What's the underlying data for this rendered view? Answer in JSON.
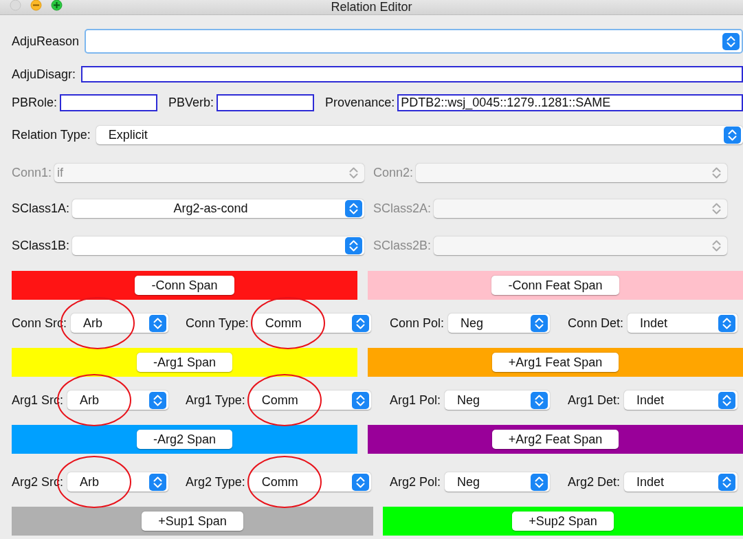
{
  "window": {
    "title": "Relation Editor"
  },
  "adju_reason": {
    "label": "AdjuReason",
    "focused": true
  },
  "adju_disagr": {
    "label": "AdjuDisagr:"
  },
  "pb_fields": [
    {
      "label": "PBRole:"
    },
    {
      "label": "PBVerb:"
    },
    {
      "label": "Provenance:",
      "value": "PDTB2::wsj_0045::1279..1281::SAME"
    }
  ],
  "relation_type": {
    "label": "Relation Type:",
    "value": "Explicit"
  },
  "class_rows": [
    [
      {
        "label": "Conn1:",
        "value": "if",
        "disabled": true
      },
      {
        "label": "Conn2:",
        "disabled": true
      }
    ],
    [
      {
        "label": "SClass1A:",
        "value": "Arg2-as-cond",
        "disabled": false
      },
      {
        "label": "SClass2A:",
        "disabled": true
      }
    ],
    [
      {
        "label": "SClass1B:",
        "disabled": false
      },
      {
        "label": "SClass2B:",
        "disabled": true
      }
    ]
  ],
  "sections": [
    {
      "spans": [
        {
          "label": "-Conn Span",
          "color": "#ff1414"
        },
        {
          "label": "-Conn Feat Span",
          "color": "#ffc0cb"
        }
      ],
      "attributes": [
        {
          "label": "Conn Src:",
          "value": "Arb",
          "circled": true
        },
        {
          "label": "Conn Type:",
          "value": "Comm",
          "circled": true
        },
        {
          "label": "Conn Pol:",
          "value": "Neg",
          "circled": false
        },
        {
          "label": "Conn Det:",
          "value": "Indet",
          "circled": false
        }
      ]
    },
    {
      "spans": [
        {
          "label": "-Arg1 Span",
          "color": "#ffff00"
        },
        {
          "label": "+Arg1 Feat Span",
          "color": "#ffa500"
        }
      ],
      "attributes": [
        {
          "label": "Arg1 Src:",
          "value": "Arb",
          "circled": true
        },
        {
          "label": "Arg1 Type:",
          "value": "Comm",
          "circled": true
        },
        {
          "label": "Arg1 Pol:",
          "value": "Neg",
          "circled": false
        },
        {
          "label": "Arg1 Det:",
          "value": "Indet",
          "circled": false
        }
      ]
    },
    {
      "spans": [
        {
          "label": "-Arg2 Span",
          "color": "#00a0ff"
        },
        {
          "label": "+Arg2 Feat Span",
          "color": "#990099"
        }
      ],
      "attributes": [
        {
          "label": "Arg2 Src:",
          "value": "Arb",
          "circled": true
        },
        {
          "label": "Arg2 Type:",
          "value": "Comm",
          "circled": true
        },
        {
          "label": "Arg2 Pol:",
          "value": "Neg",
          "circled": false
        },
        {
          "label": "Arg2 Det:",
          "value": "Indet",
          "circled": false
        }
      ]
    }
  ],
  "support_spans": [
    {
      "label": "+Sup1 Span",
      "color": "#b0b0b0"
    },
    {
      "label": "+Sup2 Span",
      "color": "#00ff00"
    }
  ]
}
